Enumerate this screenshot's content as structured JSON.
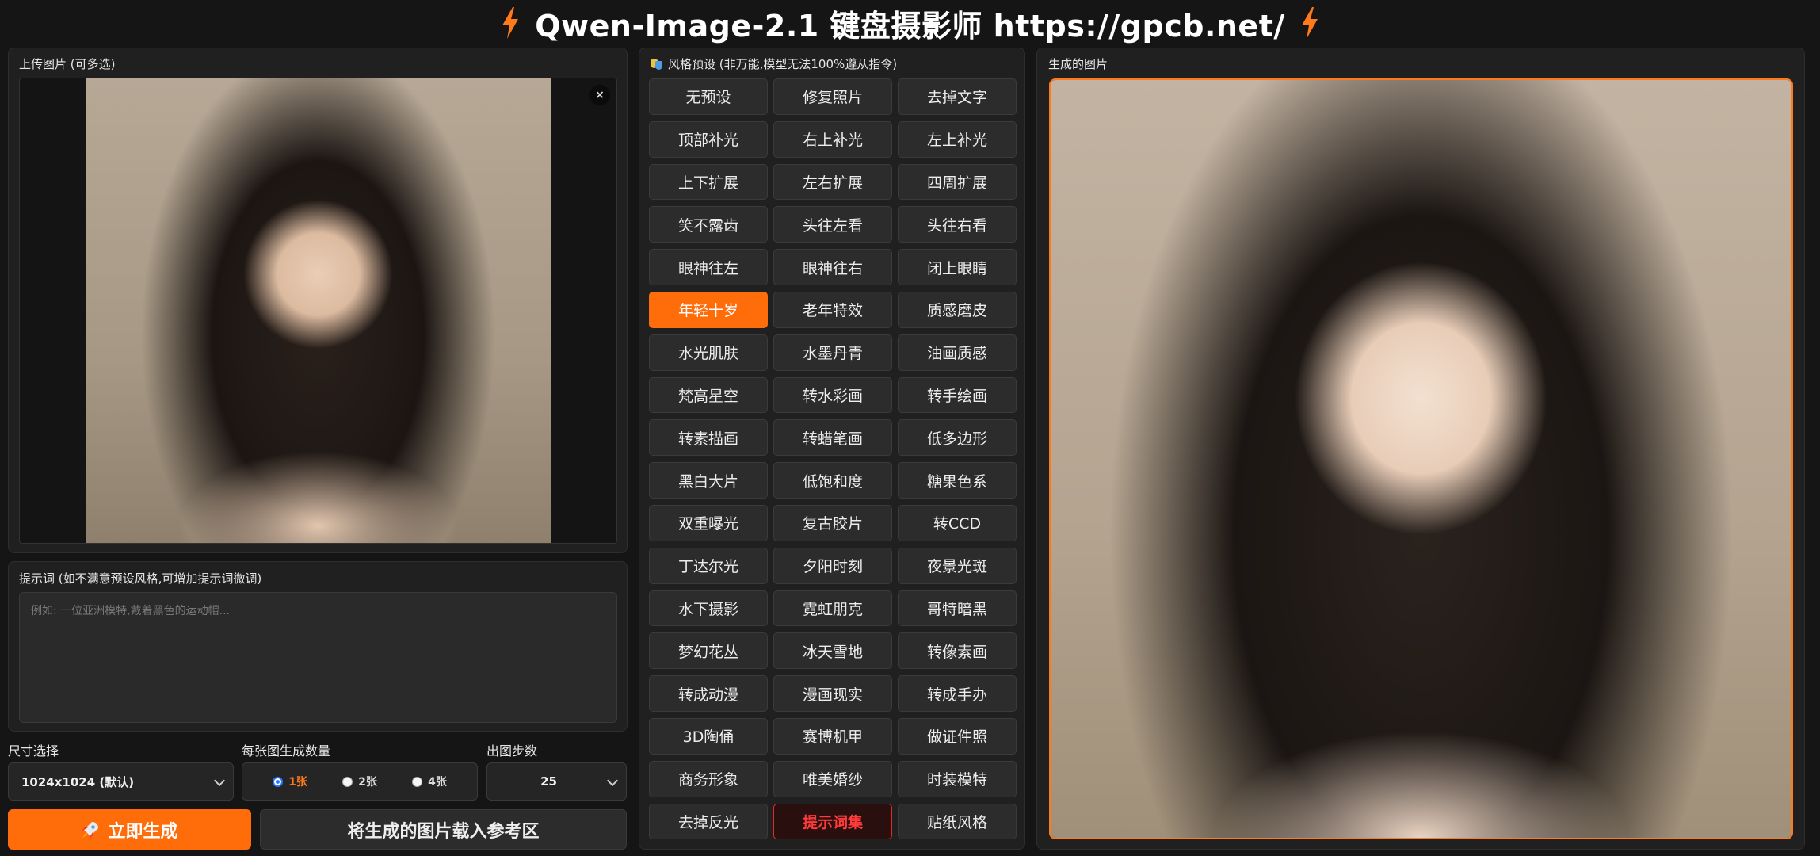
{
  "header": {
    "title": "Qwen-Image-2.1 键盘摄影师 https://gpcb.net/",
    "accent_color": "#ff6c0a",
    "icon": "lightning-bolt-icon"
  },
  "upload": {
    "label": "上传图片 (可多选)",
    "remove_label": "×"
  },
  "prompt": {
    "label": "提示词 (如不满意预设风格,可增加提示词微调)",
    "placeholder": "例如: 一位亚洲模特,戴着黑色的运动帽...",
    "value": ""
  },
  "controls": {
    "size_label": "尺寸选择",
    "size_value": "1024x1024 (默认)",
    "count_label": "每张图生成数量",
    "count_options": [
      "1张",
      "2张",
      "4张"
    ],
    "count_selected": "1张",
    "steps_label": "出图步数",
    "steps_value": "25"
  },
  "actions": {
    "generate_label": "立即生成",
    "generate_icon": "rocket-icon",
    "load_label": "将生成的图片载入参考区"
  },
  "presets": {
    "label": "风格预设 (非万能,模型无法100%遵从指令)",
    "icon": "theater-masks-icon",
    "active": "年轻十岁",
    "prompt_button": "提示词集",
    "items": [
      "无预设",
      "修复照片",
      "去掉文字",
      "顶部补光",
      "右上补光",
      "左上补光",
      "上下扩展",
      "左右扩展",
      "四周扩展",
      "笑不露齿",
      "头往左看",
      "头往右看",
      "眼神往左",
      "眼神往右",
      "闭上眼睛",
      "年轻十岁",
      "老年特效",
      "质感磨皮",
      "水光肌肤",
      "水墨丹青",
      "油画质感",
      "梵高星空",
      "转水彩画",
      "转手绘画",
      "转素描画",
      "转蜡笔画",
      "低多边形",
      "黑白大片",
      "低饱和度",
      "糖果色系",
      "双重曝光",
      "复古胶片",
      "转CCD",
      "丁达尔光",
      "夕阳时刻",
      "夜景光斑",
      "水下摄影",
      "霓虹朋克",
      "哥特暗黑",
      "梦幻花丛",
      "冰天雪地",
      "转像素画",
      "转成动漫",
      "漫画现实",
      "转成手办",
      "3D陶俑",
      "赛博机甲",
      "做证件照",
      "商务形象",
      "唯美婚纱",
      "时装模特",
      "去掉反光",
      "提示词集",
      "贴纸风格"
    ]
  },
  "output": {
    "label": "生成的图片",
    "frame_color": "#ff7a1a"
  }
}
